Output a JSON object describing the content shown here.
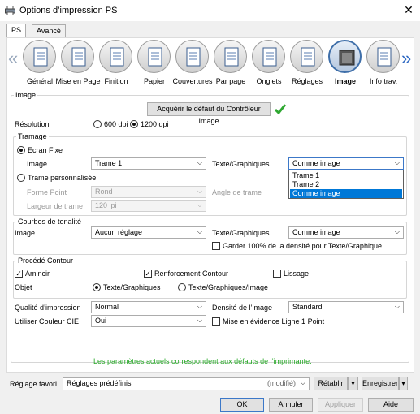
{
  "window": {
    "title": "Options d’impression PS",
    "close_glyph": "✕"
  },
  "tabs": [
    "PS",
    "Avancé"
  ],
  "ribbon": {
    "arrow_left": "«",
    "arrow_right": "»",
    "items": [
      {
        "label": "Général",
        "icon": "general-icon"
      },
      {
        "label": "Mise en Page",
        "icon": "layout-icon"
      },
      {
        "label": "Finition",
        "icon": "finishing-icon"
      },
      {
        "label": "Papier",
        "icon": "paper-icon"
      },
      {
        "label": "Couvertures",
        "icon": "covers-icon"
      },
      {
        "label": "Par page",
        "icon": "per-page-icon"
      },
      {
        "label": "Onglets",
        "icon": "tabs-icon"
      },
      {
        "label": "Réglages",
        "icon": "settings-icon"
      },
      {
        "label": "Image",
        "icon": "image-icon",
        "selected": true
      },
      {
        "label": "Info trav.",
        "icon": "job-info-icon"
      }
    ]
  },
  "image_section": {
    "title": "Image",
    "acquire_button": "Acquérir le défaut du Contrôleur Image",
    "check_color": "#2fa832",
    "resolution_label": "Résolution",
    "res_600": "600 dpi",
    "res_1200": "1200 dpi",
    "res_selected": "1200 dpi"
  },
  "tramage": {
    "title": "Tramage",
    "fixed_label": "Ecran Fixe",
    "image_label": "Image",
    "image_value": "Trame 1",
    "texte_label": "Texte/Graphiques",
    "texte_value": "Comme image",
    "dropdown_options": [
      "Trame 1",
      "Trame 2",
      "Comme image"
    ],
    "dropdown_highlighted": "Comme image",
    "custom_label": "Trame personnalisée",
    "forme_label": "Forme Point",
    "forme_value": "Rond",
    "angle_label": "Angle de trame",
    "largeur_label": "Largeur de trame",
    "largeur_value": "120 lpi"
  },
  "courbes": {
    "title": "Courbes de tonalité",
    "image_label": "Image",
    "image_value": "Aucun réglage",
    "texte_label": "Texte/Graphiques",
    "texte_value": "Comme image",
    "keep_label": "Garder 100% de la densité pour Texte/Graphique",
    "keep_checked": false
  },
  "contour": {
    "title": "Procédé Contour",
    "amincir_label": "Amincir",
    "amincir_checked": true,
    "renfort_label": "Renforcement Contour",
    "renfort_checked": true,
    "lissage_label": "Lissage",
    "lissage_checked": false,
    "objet_label": "Objet",
    "obj_texte": "Texte/Graphiques",
    "obj_texte_image": "Texte/Graphiques/Image",
    "obj_selected": "Texte/Graphiques"
  },
  "bottom_fields": {
    "qualite_label": "Qualité d’impression",
    "qualite_value": "Normal",
    "densite_label": "Densité de l’image",
    "densite_value": "Standard",
    "cie_label": "Utiliser Couleur CIE",
    "cie_value": "Oui",
    "mise_label": "Mise en évidence Ligne 1 Point",
    "mise_checked": false
  },
  "status_message": "Les paramètres actuels correspondent aux défauts de l’imprimante.",
  "status_color": "#25a825",
  "favorites": {
    "label": "Réglage favori",
    "value": "Réglages prédéfinis",
    "modified": "(modifié)",
    "retablir": "Rétablir",
    "enregistrer": "Enregistrer"
  },
  "buttons": {
    "ok": "OK",
    "annuler": "Annuler",
    "appliquer": "Appliquer",
    "aide": "Aide"
  }
}
